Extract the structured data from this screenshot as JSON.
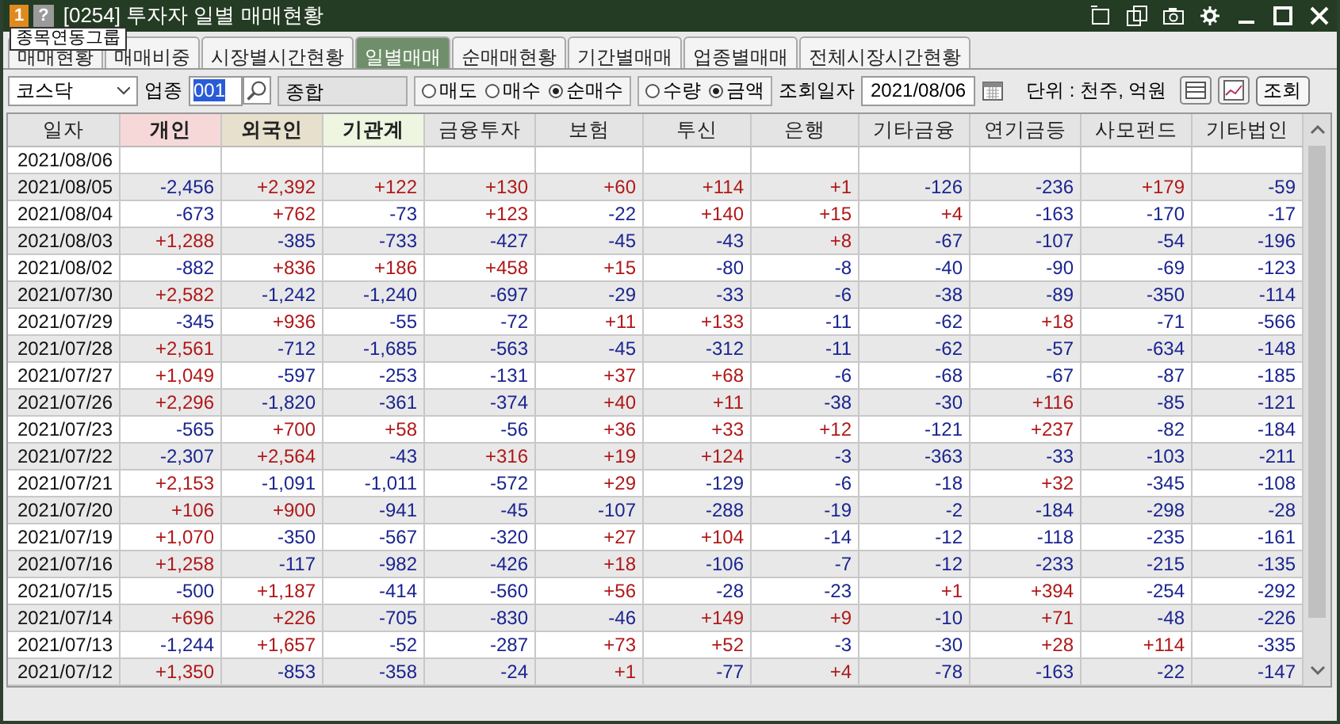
{
  "window": {
    "badge": "1",
    "help": "?",
    "title": "[0254] 투자자 일별 매매현황"
  },
  "tooltip": "종목연동그룹",
  "tabs": [
    {
      "label": "매매현황",
      "selected": false
    },
    {
      "label": "매매비중",
      "selected": false
    },
    {
      "label": "시장별시간현황",
      "selected": false
    },
    {
      "label": "일별매매",
      "selected": true
    },
    {
      "label": "순매매현황",
      "selected": false
    },
    {
      "label": "기간별매매",
      "selected": false
    },
    {
      "label": "업종별매매",
      "selected": false
    },
    {
      "label": "전체시장시간현황",
      "selected": false
    }
  ],
  "filters": {
    "market": "코스닥",
    "sector_label": "업종",
    "sector_code": "001",
    "sector_name": "종합",
    "trade_options": [
      {
        "label": "매도",
        "selected": false
      },
      {
        "label": "매수",
        "selected": false
      },
      {
        "label": "순매수",
        "selected": true
      }
    ],
    "unit_options": [
      {
        "label": "수량",
        "selected": false
      },
      {
        "label": "금액",
        "selected": true
      }
    ],
    "date_label": "조회일자",
    "date": "2021/08/06",
    "unit_text": "단위 : 천주, 억원",
    "query_button": "조회"
  },
  "table": {
    "columns": [
      {
        "label": "일자"
      },
      {
        "label": "개인",
        "color": "#f6d8d8"
      },
      {
        "label": "외국인",
        "color": "#e6e0cc"
      },
      {
        "label": "기관계",
        "color": "#eef6e2"
      },
      {
        "label": "금융투자"
      },
      {
        "label": "보험"
      },
      {
        "label": "투신"
      },
      {
        "label": "은행"
      },
      {
        "label": "기타금융"
      },
      {
        "label": "연기금등"
      },
      {
        "label": "사모펀드"
      },
      {
        "label": "기타법인"
      }
    ],
    "rows": [
      [
        "2021/08/06"
      ],
      [
        "2021/08/05",
        "-2,456",
        "+2,392",
        "+122",
        "+130",
        "+60",
        "+114",
        "+1",
        "-126",
        "-236",
        "+179",
        "-59"
      ],
      [
        "2021/08/04",
        "-673",
        "+762",
        "-73",
        "+123",
        "-22",
        "+140",
        "+15",
        "+4",
        "-163",
        "-170",
        "-17"
      ],
      [
        "2021/08/03",
        "+1,288",
        "-385",
        "-733",
        "-427",
        "-45",
        "-43",
        "+8",
        "-67",
        "-107",
        "-54",
        "-196"
      ],
      [
        "2021/08/02",
        "-882",
        "+836",
        "+186",
        "+458",
        "+15",
        "-80",
        "-8",
        "-40",
        "-90",
        "-69",
        "-123"
      ],
      [
        "2021/07/30",
        "+2,582",
        "-1,242",
        "-1,240",
        "-697",
        "-29",
        "-33",
        "-6",
        "-38",
        "-89",
        "-350",
        "-114"
      ],
      [
        "2021/07/29",
        "-345",
        "+936",
        "-55",
        "-72",
        "+11",
        "+133",
        "-11",
        "-62",
        "+18",
        "-71",
        "-566"
      ],
      [
        "2021/07/28",
        "+2,561",
        "-712",
        "-1,685",
        "-563",
        "-45",
        "-312",
        "-11",
        "-62",
        "-57",
        "-634",
        "-148"
      ],
      [
        "2021/07/27",
        "+1,049",
        "-597",
        "-253",
        "-131",
        "+37",
        "+68",
        "-6",
        "-68",
        "-67",
        "-87",
        "-185"
      ],
      [
        "2021/07/26",
        "+2,296",
        "-1,820",
        "-361",
        "-374",
        "+40",
        "+11",
        "-38",
        "-30",
        "+116",
        "-85",
        "-121"
      ],
      [
        "2021/07/23",
        "-565",
        "+700",
        "+58",
        "-56",
        "+36",
        "+33",
        "+12",
        "-121",
        "+237",
        "-82",
        "-184"
      ],
      [
        "2021/07/22",
        "-2,307",
        "+2,564",
        "-43",
        "+316",
        "+19",
        "+124",
        "-3",
        "-363",
        "-33",
        "-103",
        "-211"
      ],
      [
        "2021/07/21",
        "+2,153",
        "-1,091",
        "-1,011",
        "-572",
        "+29",
        "-129",
        "-6",
        "-18",
        "+32",
        "-345",
        "-108"
      ],
      [
        "2021/07/20",
        "+106",
        "+900",
        "-941",
        "-45",
        "-107",
        "-288",
        "-19",
        "-2",
        "-184",
        "-298",
        "-28"
      ],
      [
        "2021/07/19",
        "+1,070",
        "-350",
        "-567",
        "-320",
        "+27",
        "+104",
        "-14",
        "-12",
        "-118",
        "-235",
        "-161"
      ],
      [
        "2021/07/16",
        "+1,258",
        "-117",
        "-982",
        "-426",
        "+18",
        "-106",
        "-7",
        "-12",
        "-233",
        "-215",
        "-135"
      ],
      [
        "2021/07/15",
        "-500",
        "+1,187",
        "-414",
        "-560",
        "+56",
        "-28",
        "-23",
        "+1",
        "+394",
        "-254",
        "-292"
      ],
      [
        "2021/07/14",
        "+696",
        "+226",
        "-705",
        "-830",
        "-46",
        "+149",
        "+9",
        "-10",
        "+71",
        "-48",
        "-226"
      ],
      [
        "2021/07/13",
        "-1,244",
        "+1,657",
        "-52",
        "-287",
        "+73",
        "+52",
        "-3",
        "-30",
        "+28",
        "+114",
        "-335"
      ],
      [
        "2021/07/12",
        "+1,350",
        "-853",
        "-358",
        "-24",
        "+1",
        "-77",
        "+4",
        "-78",
        "-163",
        "-22",
        "-147"
      ]
    ]
  }
}
